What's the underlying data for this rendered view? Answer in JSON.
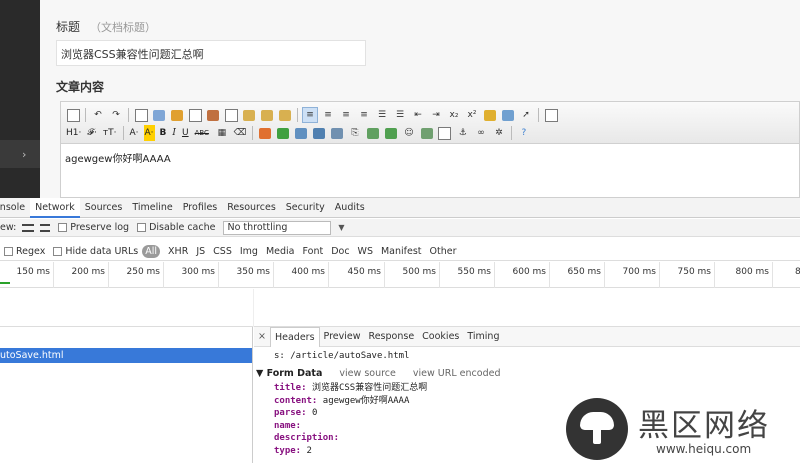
{
  "editor": {
    "title_label": "标题",
    "title_hint": "（文档标题）",
    "title_value": "浏览器CSS兼容性问题汇总啊",
    "content_label": "文章内容",
    "body_text": "agewgew你好啊AAAA",
    "toolbar": {
      "heading": "H1·",
      "font": "𝓕·",
      "size": "тT·",
      "font_color": "A·",
      "bg_color": "A·",
      "bold": "B",
      "italic": "I",
      "underline": "U",
      "strike": "ABC"
    }
  },
  "sidebar": {
    "chevron": "›"
  },
  "devtools": {
    "tabs": [
      "onsole",
      "Network",
      "Sources",
      "Timeline",
      "Profiles",
      "Resources",
      "Security",
      "Audits"
    ],
    "active_tab": "Network",
    "toolbar": {
      "view_label": "ew:",
      "preserve_log": "Preserve log",
      "disable_cache": "Disable cache",
      "throttling": "No throttling"
    },
    "filter": {
      "regex": "Regex",
      "hide_data_urls": "Hide data URLs",
      "all": "All",
      "types": [
        "XHR",
        "JS",
        "CSS",
        "Img",
        "Media",
        "Font",
        "Doc",
        "WS",
        "Manifest",
        "Other"
      ]
    },
    "timeline_ticks": [
      "150 ms",
      "200 ms",
      "250 ms",
      "300 ms",
      "350 ms",
      "400 ms",
      "450 ms",
      "500 ms",
      "550 ms",
      "600 ms",
      "650 ms",
      "700 ms",
      "750 ms",
      "800 ms",
      "8"
    ],
    "request_name": "utoSave.html",
    "detail": {
      "close": "×",
      "tabs": [
        "Headers",
        "Preview",
        "Response",
        "Cookies",
        "Timing"
      ],
      "active_tab": "Headers",
      "request_url": "s: /article/autoSave.html",
      "form_data_label": "▼ Form Data",
      "view_source": "view source",
      "view_url_encoded": "view URL encoded",
      "form_data": [
        {
          "key": "title:",
          "value": "浏览器CSS兼容性问题汇总啊"
        },
        {
          "key": "content:",
          "value": "agewgew你好啊AAAA"
        },
        {
          "key": "parse:",
          "value": "0"
        },
        {
          "key": "name:",
          "value": ""
        },
        {
          "key": "description:",
          "value": ""
        },
        {
          "key": "type:",
          "value": "2"
        }
      ]
    }
  },
  "watermark": {
    "name": "黑区网络",
    "url": "www.heiqu.com"
  },
  "colors": {
    "accent": "#3879d9",
    "highlight": "#ffd000"
  }
}
